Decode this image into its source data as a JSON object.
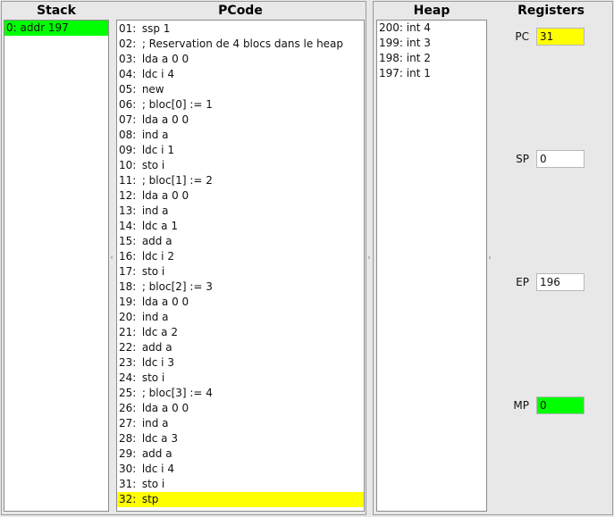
{
  "left_panel": {
    "stack_header": "Stack",
    "pcode_header": "PCode",
    "stack": [
      {
        "text": "0: addr 197",
        "highlight": "green"
      }
    ],
    "pcode": [
      {
        "num": "01:",
        "code": "ssp 1"
      },
      {
        "num": "02:",
        "code": "; Reservation de 4 blocs dans le heap"
      },
      {
        "num": "03:",
        "code": "lda a 0 0"
      },
      {
        "num": "04:",
        "code": "ldc i 4"
      },
      {
        "num": "05:",
        "code": "new"
      },
      {
        "num": "06:",
        "code": "; bloc[0] := 1"
      },
      {
        "num": "07:",
        "code": "lda a 0 0"
      },
      {
        "num": "08:",
        "code": "ind a"
      },
      {
        "num": "09:",
        "code": "ldc i 1"
      },
      {
        "num": "10:",
        "code": "sto i"
      },
      {
        "num": "11:",
        "code": "; bloc[1] := 2"
      },
      {
        "num": "12:",
        "code": "lda a 0 0"
      },
      {
        "num": "13:",
        "code": "ind a"
      },
      {
        "num": "14:",
        "code": "ldc a 1"
      },
      {
        "num": "15:",
        "code": "add a"
      },
      {
        "num": "16:",
        "code": "ldc i 2"
      },
      {
        "num": "17:",
        "code": "sto i"
      },
      {
        "num": "18:",
        "code": "; bloc[2] := 3"
      },
      {
        "num": "19:",
        "code": "lda a 0 0"
      },
      {
        "num": "20:",
        "code": "ind a"
      },
      {
        "num": "21:",
        "code": "ldc a 2"
      },
      {
        "num": "22:",
        "code": "add a"
      },
      {
        "num": "23:",
        "code": "ldc i 3"
      },
      {
        "num": "24:",
        "code": "sto i"
      },
      {
        "num": "25:",
        "code": "; bloc[3] := 4"
      },
      {
        "num": "26:",
        "code": "lda a 0 0"
      },
      {
        "num": "27:",
        "code": "ind a"
      },
      {
        "num": "28:",
        "code": "ldc a 3"
      },
      {
        "num": "29:",
        "code": "add a"
      },
      {
        "num": "30:",
        "code": "ldc i 4"
      },
      {
        "num": "31:",
        "code": "sto i"
      },
      {
        "num": "32:",
        "code": "stp",
        "highlight": "yellow"
      }
    ]
  },
  "right_panel": {
    "heap_header": "Heap",
    "registers_header": "Registers",
    "heap": [
      "200: int 4",
      "199: int 3",
      "198: int 2",
      "197: int 1"
    ],
    "registers": [
      {
        "name": "PC",
        "value": "31",
        "color": "yellow"
      },
      {
        "name": "SP",
        "value": "0",
        "color": "white"
      },
      {
        "name": "EP",
        "value": "196",
        "color": "white"
      },
      {
        "name": "MP",
        "value": "0",
        "color": "green"
      }
    ]
  },
  "colors": {
    "highlight_yellow": "#ffff00",
    "highlight_green": "#00ff00",
    "background": "#e8e8e8"
  },
  "icons": {
    "splitter_grip": "split-grip-icon"
  }
}
